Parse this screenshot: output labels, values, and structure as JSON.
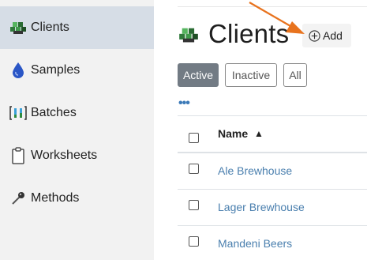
{
  "sidebar": {
    "items": [
      {
        "label": "Clients",
        "icon": "clients-icon",
        "active": true
      },
      {
        "label": "Samples",
        "icon": "samples-icon",
        "active": false
      },
      {
        "label": "Batches",
        "icon": "batches-icon",
        "active": false
      },
      {
        "label": "Worksheets",
        "icon": "worksheets-icon",
        "active": false
      },
      {
        "label": "Methods",
        "icon": "methods-icon",
        "active": false
      }
    ]
  },
  "main": {
    "title": "Clients",
    "title_icon": "clients-icon",
    "add_label": "Add",
    "filters": [
      {
        "label": "Active",
        "selected": true
      },
      {
        "label": "Inactive",
        "selected": false
      },
      {
        "label": "All",
        "selected": false
      }
    ],
    "more_label": "•••",
    "table": {
      "columns": [
        {
          "label": "Name",
          "sort": "▲"
        }
      ],
      "rows": [
        {
          "name": "Ale Brewhouse"
        },
        {
          "name": "Lager Brewhouse"
        },
        {
          "name": "Mandeni Beers"
        }
      ]
    }
  },
  "colors": {
    "active_nav_bg": "#d6dde6",
    "sidebar_bg": "#f2f2f2",
    "link": "#4a7fae",
    "active_filter_bg": "#727b84",
    "annotation_arrow": "#e8731e"
  }
}
